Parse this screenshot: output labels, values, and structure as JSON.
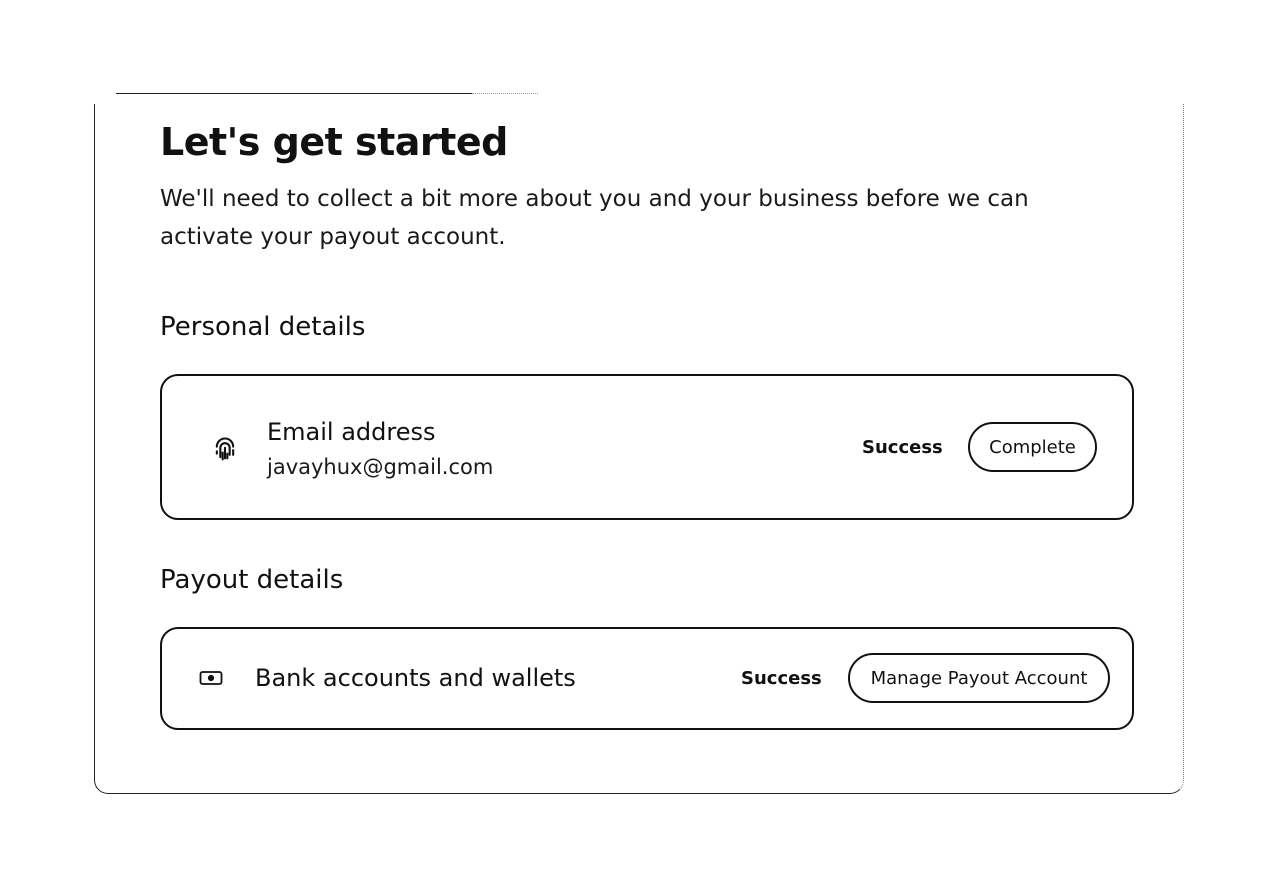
{
  "header": {
    "title": "Let's get started",
    "subtitle": "We'll need to collect a bit more about you and your business before we can activate your payout account."
  },
  "personal_section": {
    "title": "Personal details",
    "card": {
      "icon": "fingerprint-icon",
      "title": "Email address",
      "value": "javayhux@gmail.com",
      "status": "Success",
      "button_label": "Complete"
    }
  },
  "payout_section": {
    "title": "Payout details",
    "card": {
      "icon": "banknote-icon",
      "title": "Bank accounts and wallets",
      "status": "Success",
      "button_label": "Manage Payout Account"
    }
  }
}
